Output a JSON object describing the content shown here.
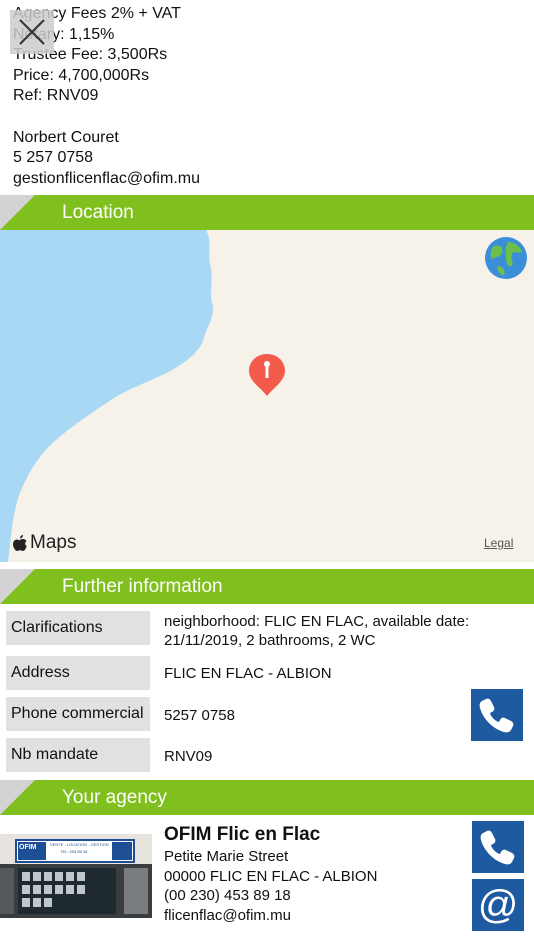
{
  "top_details": {
    "agency_fees": "Agency Fees 2% + VAT",
    "notary": "Notary: 1,15%",
    "trustee_fee": "Trustee Fee: 3,500Rs",
    "price": "Price: 4,700,000Rs",
    "ref": "Ref: RNV09",
    "contact_name": "Norbert Couret",
    "contact_phone": "5 257 0758",
    "contact_email": "gestionflicenflac@ofim.mu"
  },
  "sections": {
    "location": "Location",
    "further_info": "Further information",
    "agency": "Your agency"
  },
  "map": {
    "brand": "Maps",
    "legal": "Legal"
  },
  "further_info": {
    "rows": [
      {
        "label": "Clarifications",
        "value": "neighborhood: FLIC EN FLAC, available date: 21/11/2019, 2 bathrooms, 2 WC"
      },
      {
        "label": "Address",
        "value": "FLIC EN FLAC - ALBION"
      },
      {
        "label": "Phone commercial",
        "value": "5257 0758"
      },
      {
        "label": "Nb mandate",
        "value": "RNV09"
      }
    ]
  },
  "agency": {
    "name": "OFIM Flic en Flac",
    "street": "Petite Marie Street",
    "city": "00000 FLIC EN FLAC - ALBION",
    "phone": "(00 230) 453 89 18",
    "email": "flicenflac@ofim.mu",
    "sign_brand": "OFIM",
    "sign_text": "VENTE - LOCATION - GESTION",
    "sign_tel": "TEL: 453 89 18"
  },
  "colors": {
    "section_green": "#7fbf1e",
    "button_blue": "#1e5aa0",
    "label_gray": "#e1e1e1",
    "sea_blue": "#a9d8f4"
  }
}
